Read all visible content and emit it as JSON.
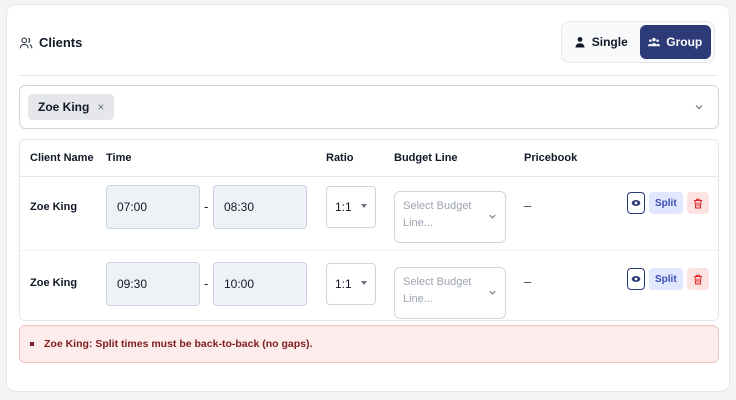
{
  "header": {
    "title": "Clients",
    "toggle": {
      "single_label": "Single",
      "group_label": "Group",
      "selected": "Group"
    }
  },
  "client_select": {
    "selected_chips": [
      "Zoe King"
    ],
    "chip_remove_glyph": "×"
  },
  "table": {
    "columns": [
      "Client Name",
      "Time",
      "Ratio",
      "Budget Line",
      "Pricebook"
    ],
    "rows": [
      {
        "client_name": "Zoe King",
        "start_time": "07:00",
        "time_separator": "-",
        "end_time": "08:30",
        "ratio": "1:1",
        "budget_line_placeholder": "Select Budget Line...",
        "budget_line_lines": [
          "Select Budget",
          "Line..."
        ],
        "pricebook": "–",
        "split_label": "Split"
      },
      {
        "client_name": "Zoe King",
        "start_time": "09:30",
        "time_separator": "-",
        "end_time": "10:00",
        "ratio": "1:1",
        "budget_line_placeholder": "Select Budget Line...",
        "budget_line_lines": [
          "Select Budget",
          "Line..."
        ],
        "pricebook": "–",
        "split_label": "Split"
      }
    ]
  },
  "errors": [
    "Zoe King: Split times must be back-to-back (no gaps)."
  ],
  "colors": {
    "primary": "#2d3a78",
    "split_bg": "#e0e7ff",
    "delete_bg": "#fde2e2",
    "error_bg": "#fdecec",
    "error_text": "#7f1d1d"
  },
  "icons": {
    "header": "users-outline-icon",
    "single": "user-icon",
    "group": "users-icon",
    "select_chevron": "chevron-down-icon",
    "view": "eye-icon",
    "delete": "trash-icon"
  }
}
